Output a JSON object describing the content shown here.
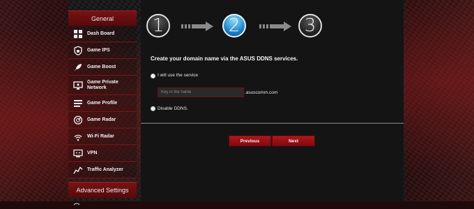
{
  "sidebar": {
    "general_header": "General",
    "advanced_header": "Advanced Settings",
    "items": [
      {
        "label": "Dash Board",
        "icon": "dashboard-icon"
      },
      {
        "label": "Game IPS",
        "icon": "shield-lock-icon"
      },
      {
        "label": "Game Boost",
        "icon": "rocket-icon"
      },
      {
        "label": "Game Private Network",
        "icon": "monitor-network-icon"
      },
      {
        "label": "Game Profile",
        "icon": "profile-list-icon"
      },
      {
        "label": "Game Radar",
        "icon": "radar-icon"
      },
      {
        "label": "Wi-Fi Radar",
        "icon": "wifi-radar-icon"
      },
      {
        "label": "VPN",
        "icon": "vpn-icon"
      },
      {
        "label": "Traffic Analyzer",
        "icon": "traffic-analyzer-icon"
      }
    ]
  },
  "wizard": {
    "steps": [
      "1",
      "2",
      "3"
    ],
    "active_step": 2,
    "title": "Create your domain name via the ASUS DDNS services.",
    "option_use": "I will use the service",
    "host_placeholder": "Key in the name",
    "domain_suffix": ".asuscomm.com",
    "option_disable": "Disable DDNS.",
    "previous_label": "Previous",
    "next_label": "Next"
  },
  "colors": {
    "accent_red": "#9a1014",
    "active_step_blue": "#1b7fc4",
    "panel_bg": "#141414"
  }
}
